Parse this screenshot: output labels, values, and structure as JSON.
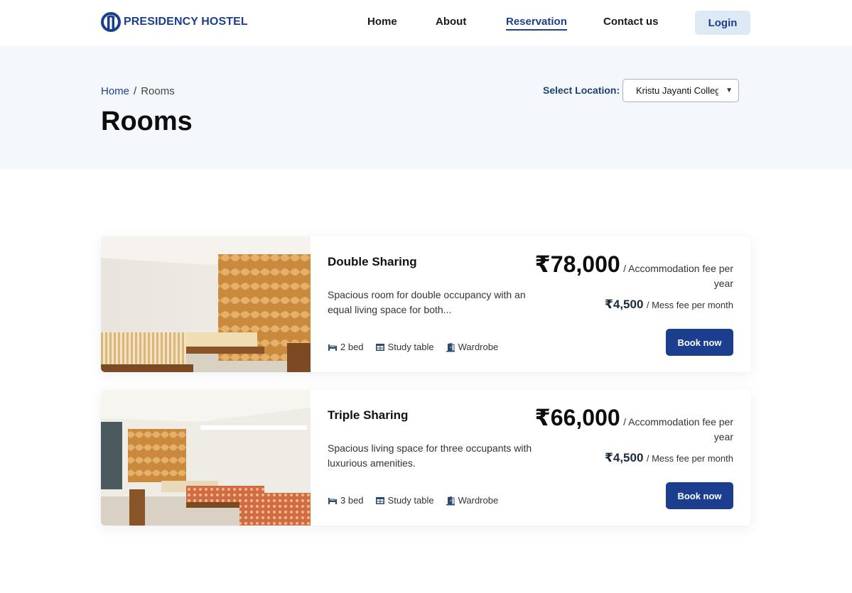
{
  "brand": {
    "name": "PRESIDENCY HOSTEL",
    "color": "#1b3f8e"
  },
  "nav": {
    "items": [
      {
        "label": "Home"
      },
      {
        "label": "About"
      },
      {
        "label": "Reservation",
        "active": true
      },
      {
        "label": "Contact us"
      }
    ],
    "login_label": "Login"
  },
  "breadcrumb": {
    "home": "Home",
    "separator": "/",
    "current": "Rooms"
  },
  "page_title": "Rooms",
  "location": {
    "label": "Select Location:",
    "selected": "Kristu Jayanti College"
  },
  "rooms": [
    {
      "name": "Double Sharing",
      "description": "Spacious room for double occupancy with an equal living space for both...",
      "price": "₹78,000",
      "price_unit": "/ Accommodation fee per year",
      "mess_price": "₹4,500",
      "mess_unit": "/ Mess fee per month",
      "amenities": {
        "beds": "2 bed",
        "table": "Study table",
        "wardrobe": "Wardrobe"
      },
      "book_label": "Book now"
    },
    {
      "name": "Triple Sharing",
      "description": "Spacious living space for three occupants with luxurious amenities.",
      "price": "₹66,000",
      "price_unit": "/ Accommodation fee per year",
      "mess_price": "₹4,500",
      "mess_unit": "/ Mess fee per month",
      "amenities": {
        "beds": "3 bed",
        "table": "Study table",
        "wardrobe": "Wardrobe"
      },
      "book_label": "Book now"
    }
  ],
  "icons": {
    "bed": "bed-icon",
    "table": "study-table-icon",
    "wardrobe": "wardrobe-icon"
  }
}
